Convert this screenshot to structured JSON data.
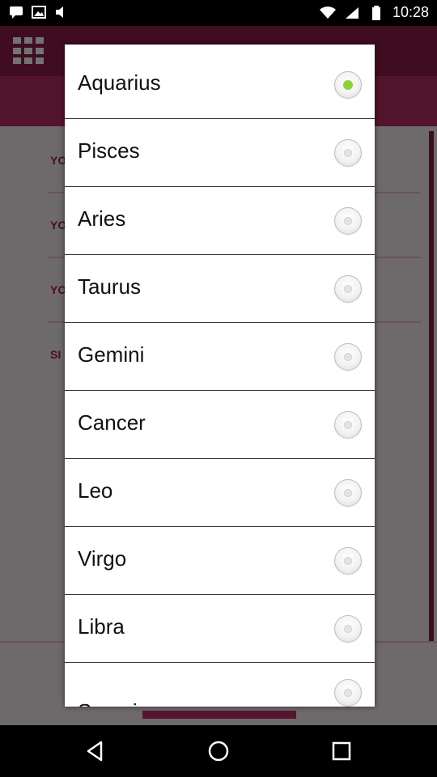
{
  "status_bar": {
    "time": "10:28",
    "icons_left": [
      "message-icon",
      "image-icon",
      "sound-icon"
    ],
    "icons_right": [
      "wifi-icon",
      "signal-icon",
      "battery-icon"
    ]
  },
  "background": {
    "labels": [
      "YO",
      "YO",
      "YO",
      "SI"
    ]
  },
  "dialog": {
    "options": [
      {
        "label": "Aquarius",
        "selected": true
      },
      {
        "label": "Pisces",
        "selected": false
      },
      {
        "label": "Aries",
        "selected": false
      },
      {
        "label": "Taurus",
        "selected": false
      },
      {
        "label": "Gemini",
        "selected": false
      },
      {
        "label": "Cancer",
        "selected": false
      },
      {
        "label": "Leo",
        "selected": false
      },
      {
        "label": "Virgo",
        "selected": false
      },
      {
        "label": "Libra",
        "selected": false
      },
      {
        "label": "Scorpio",
        "selected": false
      }
    ]
  },
  "colors": {
    "accent": "#8bd438",
    "app_header": "#8e1b4a"
  },
  "nav_bar": {
    "icons": [
      "back-icon",
      "home-icon",
      "recents-icon"
    ]
  }
}
